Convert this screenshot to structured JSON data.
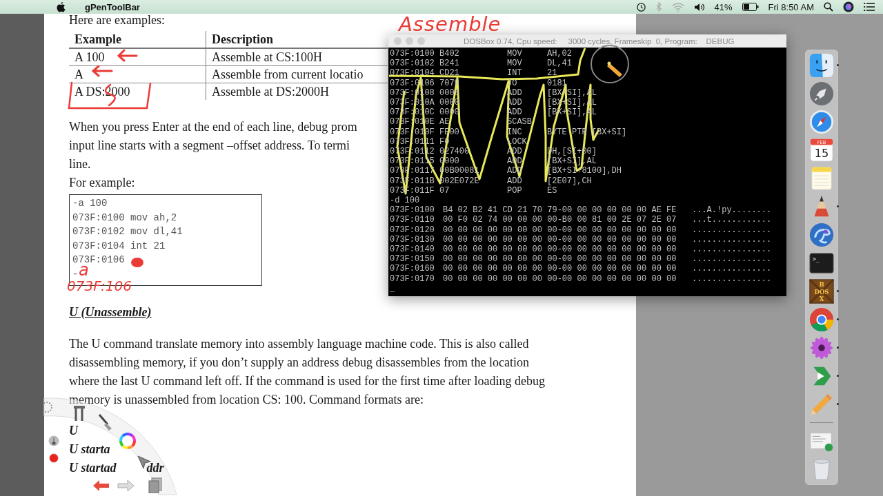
{
  "menu_bar": {
    "app_name": "gPenToolBar",
    "battery_percent": "41%",
    "clock": "Fri 8:50 AM"
  },
  "document": {
    "intro": "Here are examples:",
    "table": {
      "columns": [
        "Example",
        "Description"
      ],
      "rows": [
        [
          "A 100",
          "Assemble at CS:100H"
        ],
        [
          "A",
          "Assemble from current locatio"
        ],
        [
          "A DS:2000",
          "Assemble at DS:2000H"
        ]
      ]
    },
    "paragraph_lines": [
      "When you press Enter at the end of each line, debug prom",
      "input line starts with a segment –offset address. To termi",
      "line."
    ],
    "for_example": "For example:",
    "code_lines": [
      "-a 100",
      "073F:0100 mov ah,2",
      "073F:0102 mov dl,41",
      "073F:0104 int 21",
      "073F:0106",
      "-"
    ],
    "section_heading": "U (Unassemble)",
    "body_lines": [
      "The U command translate memory into assembly language machine code. This is also called",
      "disassembling memory, if you don’t supply an address debug disassembles from the location",
      "where the last U command left off. If the command is used for the first time after loading debug",
      "memory is unassembled from location CS: 100. Command formats are:"
    ],
    "command_lines": [
      {
        "text": "U"
      },
      {
        "text": "U starta"
      },
      {
        "text": "U startad",
        "tail": "ddr"
      }
    ]
  },
  "annotations": {
    "title": "Assemble",
    "code_letter": "a",
    "code_note": "073F:106"
  },
  "dosbox": {
    "title": "DOSBox 0.74, Cpu speed:     3000 cycles, Frameskip  0, Program:    DEBUG",
    "disassembly": [
      {
        "address": "073F:0100",
        "bytes": "B402",
        "mnemonic": "MOV",
        "operands": "AH,02"
      },
      {
        "address": "073F:0102",
        "bytes": "B241",
        "mnemonic": "MOV",
        "operands": "DL,41"
      },
      {
        "address": "073F:0104",
        "bytes": "CD21",
        "mnemonic": "INT",
        "operands": "21"
      },
      {
        "address": "073F:0106",
        "bytes": "7079",
        "mnemonic": "JO",
        "operands": "0181"
      },
      {
        "address": "073F:0108",
        "bytes": "0000",
        "mnemonic": "ADD",
        "operands": "[BX+SI],AL"
      },
      {
        "address": "073F:010A",
        "bytes": "0000",
        "mnemonic": "ADD",
        "operands": "[BX+SI],AL"
      },
      {
        "address": "073F:010C",
        "bytes": "0000",
        "mnemonic": "ADD",
        "operands": "[BX+SI],AL"
      },
      {
        "address": "073F:010E",
        "bytes": "AE",
        "mnemonic": "SCASB"
      },
      {
        "address": "073F:010F",
        "bytes": "FE00",
        "mnemonic": "INC",
        "operands": "BYTE PTR [BX+SI]"
      },
      {
        "address": "073F:0111",
        "bytes": "F0",
        "mnemonic": "LOCK"
      },
      {
        "address": "073F:0112",
        "bytes": "027400",
        "mnemonic": "ADD",
        "operands": "DH,[SI+00]"
      },
      {
        "address": "073F:0115",
        "bytes": "0000",
        "mnemonic": "ADD",
        "operands": "[BX+SI],AL"
      },
      {
        "address": "073F:0117",
        "bytes": "00B00081",
        "mnemonic": "ADD",
        "operands": "[BX+SI+8100],DH"
      },
      {
        "address": "073F:011B",
        "bytes": "002E072E",
        "mnemonic": "ADD",
        "operands": "[2E07],CH"
      },
      {
        "address": "073F:011F",
        "bytes": "07",
        "mnemonic": "POP",
        "operands": "ES"
      }
    ],
    "command": "-d 100",
    "dump": [
      {
        "address": "073F:0100",
        "hex": "B4 02 B2 41 CD 21 70 79-00 00 00 00 00 00 AE FE",
        "ascii": "...A.!py........"
      },
      {
        "address": "073F:0110",
        "hex": "00 F0 02 74 00 00 00 00-B0 00 81 00 2E 07 2E 07",
        "ascii": "...t............"
      },
      {
        "address": "073F:0120",
        "hex": "00 00 00 00 00 00 00 00-00 00 00 00 00 00 00 00",
        "ascii": "................"
      },
      {
        "address": "073F:0130",
        "hex": "00 00 00 00 00 00 00 00-00 00 00 00 00 00 00 00",
        "ascii": "................"
      },
      {
        "address": "073F:0140",
        "hex": "00 00 00 00 00 00 00 00-00 00 00 00 00 00 00 00",
        "ascii": "................"
      },
      {
        "address": "073F:0150",
        "hex": "00 00 00 00 00 00 00 00-00 00 00 00 00 00 00 00",
        "ascii": "................"
      },
      {
        "address": "073F:0160",
        "hex": "00 00 00 00 00 00 00 00-00 00 00 00 00 00 00 00",
        "ascii": "................"
      },
      {
        "address": "073F:0170",
        "hex": "00 00 00 00 00 00 00 00-00 00 00 00 00 00 00 00",
        "ascii": "................"
      }
    ],
    "prompt": "_"
  },
  "dock": {
    "items": [
      {
        "kind": "finder",
        "running": true
      },
      {
        "kind": "launchpad",
        "running": false
      },
      {
        "kind": "safari",
        "running": false
      },
      {
        "kind": "calendar",
        "running": false,
        "month": "FEB",
        "day": "15"
      },
      {
        "kind": "notes",
        "running": false
      },
      {
        "kind": "sketch",
        "running": true
      },
      {
        "kind": "chameleon",
        "running": false
      },
      {
        "kind": "terminal",
        "running": false,
        "label": ">_"
      },
      {
        "kind": "dosbox",
        "running": true,
        "top": "B",
        "middle": "DOS",
        "bottom": "X"
      },
      {
        "kind": "chrome",
        "running": true
      },
      {
        "kind": "flower",
        "running": true
      },
      {
        "kind": "green-app",
        "running": true
      },
      {
        "kind": "pencil",
        "running": true
      },
      {
        "kind": "screenshot",
        "running": false
      },
      {
        "kind": "trash",
        "running": false
      }
    ]
  }
}
